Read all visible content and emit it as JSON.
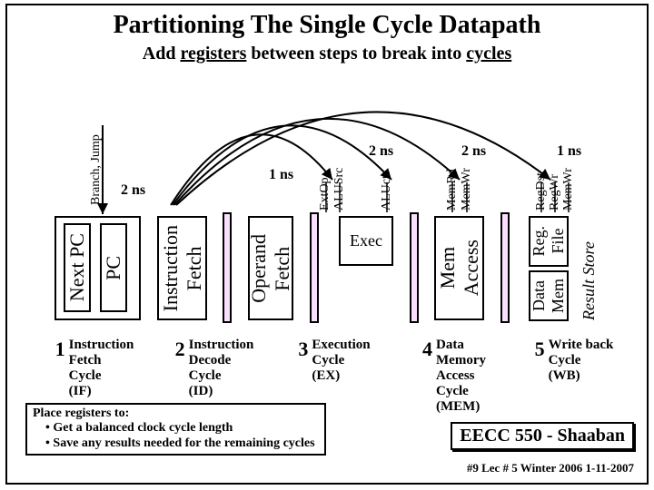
{
  "title": "Partitioning The Single Cycle Datapath",
  "subtitle_parts": {
    "pre": "Add ",
    "u1": "registers",
    "mid": " between steps to break into ",
    "u2": "cycles"
  },
  "timings": {
    "t1": "2 ns",
    "t2": "1 ns",
    "t3": "2 ns",
    "t4": "2 ns",
    "t5": "1 ns"
  },
  "labels": {
    "branch": "Branch,  Jump",
    "nextpc": "Next PC",
    "pc": "PC",
    "ifetch": "Instruction\nFetch",
    "ofetch": "Operand\nFetch",
    "extop": "ExtOp",
    "alusrc": "ALUSrc",
    "aluctr": "ALUctr",
    "exec": "Exec",
    "memrd": "MemRd",
    "memwr": "MemWr",
    "memacc": "Mem\nAccess",
    "regdst": "RegDst",
    "regwr": "RegWr",
    "memwr2": "MemWr",
    "regfile": "Reg.\nFile",
    "datamem": "Data\nMem",
    "result": "Result Store"
  },
  "stages": [
    {
      "num": "1",
      "lines": [
        "Instruction",
        "Fetch",
        "Cycle",
        "(IF)"
      ]
    },
    {
      "num": "2",
      "lines": [
        "Instruction",
        "Decode",
        "Cycle",
        "(ID)"
      ]
    },
    {
      "num": "3",
      "lines": [
        "Execution",
        "Cycle",
        "(EX)",
        ""
      ]
    },
    {
      "num": "4",
      "lines": [
        "Data",
        "Memory",
        "Access",
        "Cycle",
        "(MEM)"
      ]
    },
    {
      "num": "5",
      "lines": [
        "Write back",
        "Cycle",
        "(WB)",
        ""
      ]
    }
  ],
  "place": {
    "head": "Place registers to:",
    "b1": "Get a balanced clock cycle length",
    "b2": "Save any results needed for the remaining cycles"
  },
  "footer1": "EECC 550 - Shaaban",
  "footer2": "#9  Lec # 5  Winter 2006  1-11-2007"
}
